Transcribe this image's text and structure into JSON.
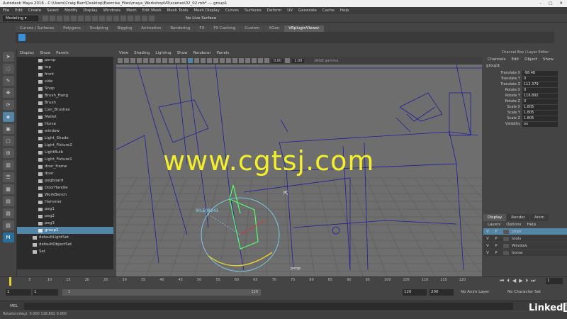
{
  "window": {
    "title": "Autodesk Maya 2016 - C:\\Users\\Craig Barr\\Desktop\\Exercise_Files\\maya_WorkshopVR\\scenes\\02_02.mb* --- group1"
  },
  "menubar": [
    "File",
    "Edit",
    "Create",
    "Select",
    "Modify",
    "Display",
    "Windows",
    "Mesh",
    "Edit Mesh",
    "Mesh Tools",
    "Mesh Display",
    "Curves",
    "Surfaces",
    "Deform",
    "UV",
    "Generate",
    "Cache",
    "Help"
  ],
  "statusline": {
    "mode": "Modeling",
    "live_surface": "No Live Surface"
  },
  "shelf_tabs": [
    {
      "label": "Curves / Surfaces",
      "active": false
    },
    {
      "label": "Polygons",
      "active": false
    },
    {
      "label": "Sculpting",
      "active": false
    },
    {
      "label": "Rigging",
      "active": false
    },
    {
      "label": "Animation",
      "active": false
    },
    {
      "label": "Rendering",
      "active": false
    },
    {
      "label": "FX",
      "active": false
    },
    {
      "label": "FX Caching",
      "active": false
    },
    {
      "label": "Custom",
      "active": false
    },
    {
      "label": "XGen",
      "active": false
    },
    {
      "label": "VRpluginViewer",
      "active": true
    }
  ],
  "outliner": {
    "menu": [
      "Display",
      "Show",
      "Panels"
    ],
    "items": [
      {
        "label": "persp",
        "kind": "camera"
      },
      {
        "label": "top",
        "kind": "camera"
      },
      {
        "label": "front",
        "kind": "camera"
      },
      {
        "label": "side",
        "kind": "camera"
      },
      {
        "label": "Shop",
        "kind": "mesh"
      },
      {
        "label": "Brush_Hang",
        "kind": "mesh"
      },
      {
        "label": "Brush",
        "kind": "mesh"
      },
      {
        "label": "Can_Brushes",
        "kind": "mesh"
      },
      {
        "label": "Mallet",
        "kind": "mesh"
      },
      {
        "label": "Horse",
        "kind": "mesh"
      },
      {
        "label": "window",
        "kind": "mesh"
      },
      {
        "label": "Light_Shade",
        "kind": "mesh"
      },
      {
        "label": "Light_Fixture2",
        "kind": "mesh"
      },
      {
        "label": "LightBulb",
        "kind": "mesh"
      },
      {
        "label": "Light_Fixture1",
        "kind": "mesh"
      },
      {
        "label": "door_frame",
        "kind": "mesh"
      },
      {
        "label": "door",
        "kind": "mesh"
      },
      {
        "label": "pegboard",
        "kind": "mesh"
      },
      {
        "label": "DoorHandle",
        "kind": "mesh"
      },
      {
        "label": "WorkBench",
        "kind": "mesh"
      },
      {
        "label": "Hammer",
        "kind": "mesh"
      },
      {
        "label": "peg1",
        "kind": "mesh"
      },
      {
        "label": "peg2",
        "kind": "mesh"
      },
      {
        "label": "peg3",
        "kind": "mesh"
      },
      {
        "label": "group1",
        "kind": "group",
        "selected": true
      },
      {
        "label": "defaultLightSet",
        "kind": "set"
      },
      {
        "label": "defaultObjectSet",
        "kind": "set"
      },
      {
        "label": "Set",
        "kind": "set"
      }
    ]
  },
  "viewport": {
    "menu": [
      "View",
      "Shading",
      "Lighting",
      "Show",
      "Renderer",
      "Panels"
    ],
    "exposure": "0.00",
    "gamma": "1.00",
    "colorspace": "sRGB gamma",
    "camera_label": "persp",
    "angle_readout": "90.508241",
    "watermark": "www.cgtsj.com"
  },
  "channelbox": {
    "title": "Channel Box / Layer Editor",
    "menu": [
      "Channels",
      "Edit",
      "Object",
      "Show"
    ],
    "object": "group1",
    "attributes": [
      {
        "label": "Translate X",
        "value": "-98.48"
      },
      {
        "label": "Translate Y",
        "value": "0"
      },
      {
        "label": "Translate Z",
        "value": "112.379"
      },
      {
        "label": "Rotate X",
        "value": "0"
      },
      {
        "label": "Rotate Y",
        "value": "116.892"
      },
      {
        "label": "Rotate Z",
        "value": "0"
      },
      {
        "label": "Scale X",
        "value": "1.805"
      },
      {
        "label": "Scale Y",
        "value": "1.805"
      },
      {
        "label": "Scale Z",
        "value": "1.805"
      },
      {
        "label": "Visibility",
        "value": "on"
      }
    ]
  },
  "layers": {
    "tabs": [
      {
        "label": "Display",
        "active": true
      },
      {
        "label": "Render",
        "active": false
      },
      {
        "label": "Anim",
        "active": false
      }
    ],
    "menu": [
      "Layers",
      "Options",
      "Help"
    ],
    "items": [
      {
        "v": "V",
        "p": "P",
        "name": "chair",
        "active": true
      },
      {
        "v": "V",
        "p": "P",
        "name": "tools",
        "active": false
      },
      {
        "v": "V",
        "p": "P",
        "name": "Window",
        "active": false
      },
      {
        "v": "V",
        "p": "P",
        "name": "horse",
        "active": false
      }
    ]
  },
  "timeline": {
    "ticks": [
      "5",
      "10",
      "15",
      "20",
      "25",
      "30",
      "35",
      "40",
      "45",
      "50",
      "55",
      "60",
      "65",
      "70",
      "75",
      "80",
      "85",
      "90",
      "95",
      "100",
      "105",
      "110",
      "115",
      "120"
    ],
    "current_frame": "1",
    "range_start": "1",
    "playback_start": "1",
    "range_field_start": "1",
    "range_field_end": "120",
    "playback_end": "120",
    "anim_end": "200",
    "anim_layer": "No Anim Layer",
    "character_set": "No Character Set"
  },
  "cmdline": {
    "label": "MEL"
  },
  "helpline": {
    "text": "Rotation(deg):   0.000      118.892     0.000"
  },
  "brand": {
    "text": "Linked",
    "box": "in"
  }
}
